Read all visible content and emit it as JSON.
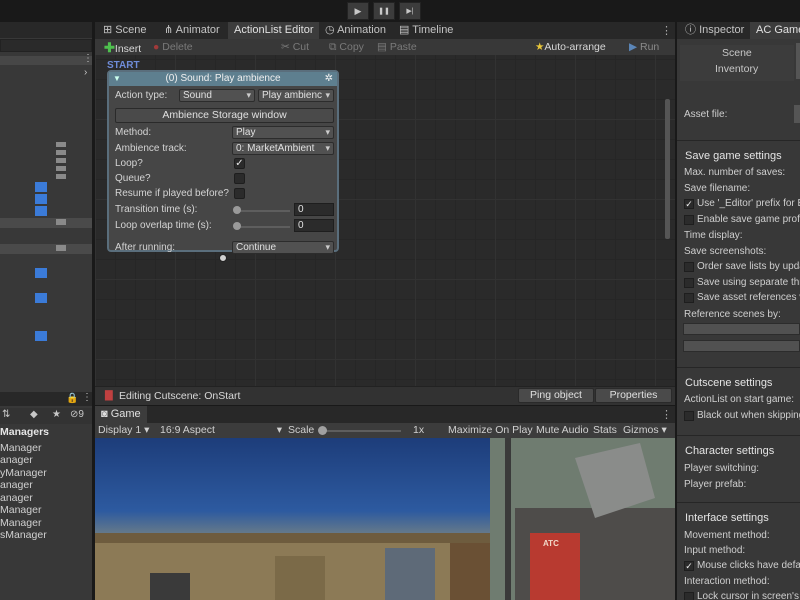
{
  "toolbar": {
    "play": "▶",
    "pause": "❚❚",
    "step": "▶|"
  },
  "left": {
    "bottom_header": "Managers",
    "managers": [
      "Manager",
      "anager",
      "yManager",
      "anager",
      "anager",
      "Manager",
      "Manager",
      "sManager"
    ]
  },
  "tabs": {
    "scene": "Scene",
    "animator": "Animator",
    "actionlist_editor": "ActionList Editor",
    "animation": "Animation",
    "timeline": "Timeline",
    "inspector": "Inspector",
    "ac_game": "AC Game"
  },
  "ale": {
    "insert": "Insert",
    "delete": "Delete",
    "cut": "Cut",
    "copy": "Copy",
    "paste": "Paste",
    "auto_arrange": "Auto-arrange",
    "run": "Run",
    "start": "START",
    "node": {
      "title": "(0) Sound: Play ambience",
      "action_type_label": "Action type:",
      "action_type_value": "Sound",
      "action_value": "Play ambienc",
      "ambience_button": "Ambience Storage window",
      "method_label": "Method:",
      "method_value": "Play",
      "track_label": "Ambience track:",
      "track_value": "0: MarketAmbient",
      "loop_label": "Loop?",
      "queue_label": "Queue?",
      "resume_label": "Resume if played before?",
      "transition_label": "Transition time (s):",
      "transition_value": "0",
      "overlap_label": "Loop overlap time (s):",
      "overlap_value": "0",
      "after_label": "After running:",
      "after_value": "Continue"
    },
    "footer_title": "Editing Cutscene: OnStart",
    "ping": "Ping object",
    "properties": "Properties"
  },
  "game": {
    "tab": "Game",
    "display": "Display 1",
    "aspect": "16:9 Aspect",
    "scale_label": "Scale",
    "scale_value": "1x",
    "maximize": "Maximize On Play",
    "mute": "Mute Audio",
    "stats": "Stats",
    "gizmos": "Gizmos",
    "sign": "ATC"
  },
  "inspector": {
    "scene": "Scene",
    "inventory": "Inventory",
    "asset_file": "Asset file:",
    "save_header": "Save game settings",
    "max_saves": "Max. number of saves:",
    "save_filename": "Save filename:",
    "use_editor": "Use '_Editor' prefix for E",
    "enable_profiles": "Enable save game profi",
    "time_display": "Time display:",
    "save_screens": "Save screenshots:",
    "order_saves": "Order save lists by upda",
    "separate_thread": "Save using separate thr",
    "asset_refs": "Save asset references v",
    "ref_scenes": "Reference scenes by:",
    "cutscene_header": "Cutscene settings",
    "actionlist_start": "ActionList on start game:",
    "black_out": "Black out when skipping",
    "character_header": "Character settings",
    "player_switching": "Player switching:",
    "player_prefab": "Player prefab:",
    "interface_header": "Interface settings",
    "movement_method": "Movement method:",
    "input_method": "Input method:",
    "mouse_clicks": "Mouse clicks have defa",
    "interaction_method": "Interaction method:",
    "lock_cursor": "Lock cursor in screen's"
  },
  "colors": {
    "accent_blue": "#3b7bd8",
    "node_header": "#5e7f8f",
    "insert_green": "#4ec04e"
  }
}
